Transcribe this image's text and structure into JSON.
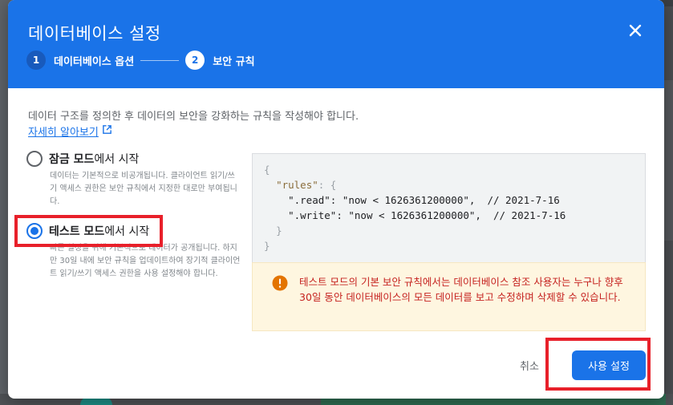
{
  "dialog": {
    "title": "데이터베이스 설정",
    "close_icon": "close-icon",
    "steps": [
      {
        "number": "1",
        "label": "데이터베이스 옵션",
        "active": false
      },
      {
        "number": "2",
        "label": "보안 규칙",
        "active": true
      }
    ],
    "intro": "데이터 구조를 정의한 후 데이터의 보안을 강화하는 규칙을 작성해야 합니다.",
    "learn_more": "자세히 알아보기",
    "options": [
      {
        "label_bold": "잠금 모드",
        "label_rest": "에서 시작",
        "description": "데이터는 기본적으로 비공개됩니다. 클라이언트 읽기/쓰기 액세스 권한은 보안 규칙에서 지정한 대로만 부여됩니다.",
        "selected": false
      },
      {
        "label_bold": "테스트 모드",
        "label_rest": "에서 시작",
        "description": "빠른 설정을 위해 기본적으로 데이터가 공개됩니다. 하지만 30일 내에 보안 규칙을 업데이트하여 장기적 클라이언트 읽기/쓰기 액세스 권한을 사용 설정해야 합니다.",
        "selected": true
      }
    ],
    "rules_code": {
      "line1": "{",
      "line2_key": "\"rules\"",
      "line2_rest": ": {",
      "line3": "\".read\": \"now < 1626361200000\",  // 2021-7-16",
      "line4": "\".write\": \"now < 1626361200000\",  // 2021-7-16",
      "line5": "}",
      "line6": "}"
    },
    "warning": {
      "icon": "warning-icon",
      "text": "테스트 모드의 기본 보안 규칙에서는 데이터베이스 참조 사용자는 누구나 향후 30일 동안 데이터베이스의 모든 데이터를 보고 수정하며 삭제할 수 있습니다."
    },
    "cancel_label": "취소",
    "submit_label": "사용 설정"
  },
  "colors": {
    "header": "#1a73e8",
    "highlight": "#e8202a",
    "warning_text": "#c5221f",
    "warning_bg": "#fef6e0"
  }
}
